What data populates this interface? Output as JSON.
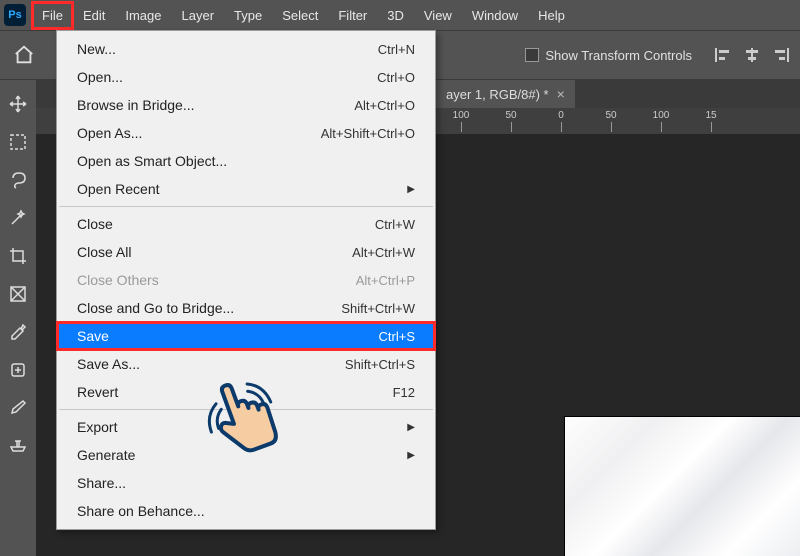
{
  "app": {
    "logo_text": "Ps"
  },
  "menubar": {
    "items": [
      {
        "label": "File",
        "highlighted": true
      },
      {
        "label": "Edit",
        "highlighted": false
      },
      {
        "label": "Image",
        "highlighted": false
      },
      {
        "label": "Layer",
        "highlighted": false
      },
      {
        "label": "Type",
        "highlighted": false
      },
      {
        "label": "Select",
        "highlighted": false
      },
      {
        "label": "Filter",
        "highlighted": false
      },
      {
        "label": "3D",
        "highlighted": false
      },
      {
        "label": "View",
        "highlighted": false
      },
      {
        "label": "Window",
        "highlighted": false
      },
      {
        "label": "Help",
        "highlighted": false
      }
    ]
  },
  "options_bar": {
    "show_transform_controls_label": "Show Transform Controls"
  },
  "doc_tab": {
    "title": "ayer 1, RGB/8#) *",
    "close_glyph": "×"
  },
  "ruler": {
    "ticks": [
      "100",
      "50",
      "0",
      "50",
      "100",
      "15"
    ]
  },
  "file_menu": {
    "groups": [
      [
        {
          "label": "New...",
          "shortcut": "Ctrl+N",
          "disabled": false,
          "selected": false,
          "submenu": false
        },
        {
          "label": "Open...",
          "shortcut": "Ctrl+O",
          "disabled": false,
          "selected": false,
          "submenu": false
        },
        {
          "label": "Browse in Bridge...",
          "shortcut": "Alt+Ctrl+O",
          "disabled": false,
          "selected": false,
          "submenu": false
        },
        {
          "label": "Open As...",
          "shortcut": "Alt+Shift+Ctrl+O",
          "disabled": false,
          "selected": false,
          "submenu": false
        },
        {
          "label": "Open as Smart Object...",
          "shortcut": "",
          "disabled": false,
          "selected": false,
          "submenu": false
        },
        {
          "label": "Open Recent",
          "shortcut": "",
          "disabled": false,
          "selected": false,
          "submenu": true
        }
      ],
      [
        {
          "label": "Close",
          "shortcut": "Ctrl+W",
          "disabled": false,
          "selected": false,
          "submenu": false
        },
        {
          "label": "Close All",
          "shortcut": "Alt+Ctrl+W",
          "disabled": false,
          "selected": false,
          "submenu": false
        },
        {
          "label": "Close Others",
          "shortcut": "Alt+Ctrl+P",
          "disabled": true,
          "selected": false,
          "submenu": false
        },
        {
          "label": "Close and Go to Bridge...",
          "shortcut": "Shift+Ctrl+W",
          "disabled": false,
          "selected": false,
          "submenu": false
        },
        {
          "label": "Save",
          "shortcut": "Ctrl+S",
          "disabled": false,
          "selected": true,
          "submenu": false
        },
        {
          "label": "Save As...",
          "shortcut": "Shift+Ctrl+S",
          "disabled": false,
          "selected": false,
          "submenu": false
        },
        {
          "label": "Revert",
          "shortcut": "F12",
          "disabled": false,
          "selected": false,
          "submenu": false
        }
      ],
      [
        {
          "label": "Export",
          "shortcut": "",
          "disabled": false,
          "selected": false,
          "submenu": true
        },
        {
          "label": "Generate",
          "shortcut": "",
          "disabled": false,
          "selected": false,
          "submenu": true
        },
        {
          "label": "Share...",
          "shortcut": "",
          "disabled": false,
          "selected": false,
          "submenu": false
        },
        {
          "label": "Share on Behance...",
          "shortcut": "",
          "disabled": false,
          "selected": false,
          "submenu": false
        }
      ]
    ]
  },
  "tools": [
    "move-tool",
    "marquee-tool",
    "lasso-tool",
    "magic-wand-tool",
    "crop-tool",
    "frame-tool",
    "eyedropper-tool",
    "healing-brush-tool",
    "brush-tool",
    "clone-stamp-tool"
  ]
}
